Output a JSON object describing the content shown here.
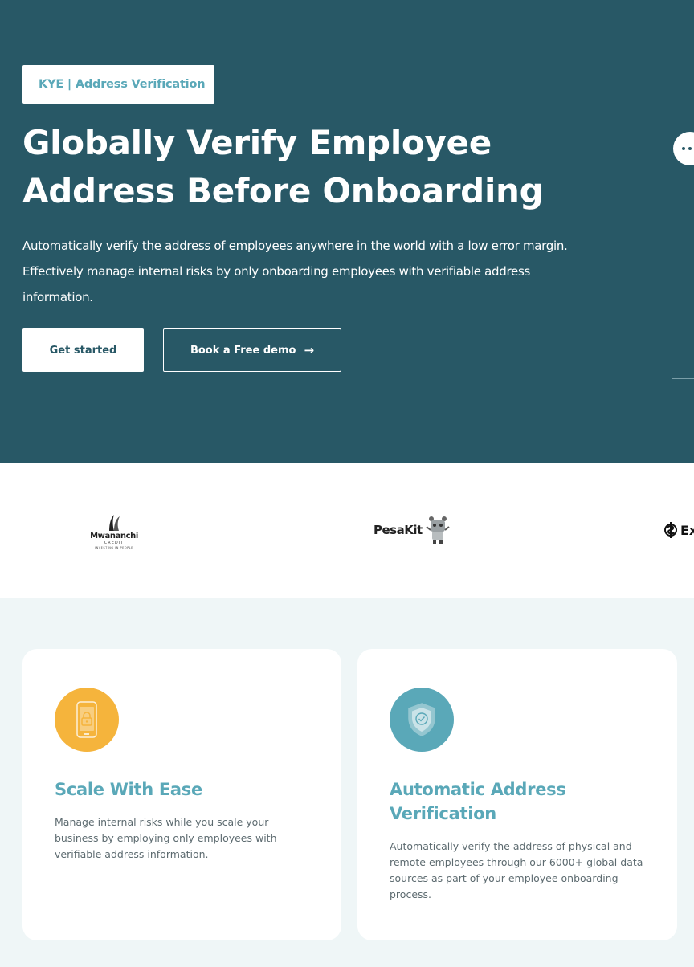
{
  "hero": {
    "tag": "KYE | Address Verification",
    "headline_line1": "Globally Verify Employee",
    "headline_line2": "Address Before Onboarding",
    "subtitle": "Automatically verify the address of employees anywhere in the world with a low error margin. Effectively manage internal risks by only onboarding employees with verifiable address information.",
    "primary_cta": "Get started",
    "secondary_cta": "Book a Free demo",
    "secondary_cta_icon": "arrow-right-icon",
    "background_color": "#285866",
    "accent_color": "#5aa8b8"
  },
  "logos": [
    {
      "name": "Mwananchi",
      "sub": "CREDIT",
      "tagline": "INVESTING IN PEOPLE"
    },
    {
      "name": "PesaKit"
    },
    {
      "name": "Ex"
    }
  ],
  "features": [
    {
      "icon": "phone-lock-icon",
      "icon_color": "#f5b43c",
      "title": "Scale With Ease",
      "description": "Manage internal risks while you scale your business by employing only employees with verifiable address information."
    },
    {
      "icon": "shield-check-icon",
      "icon_color": "#5aa8b8",
      "title": "Automatic Address Verification",
      "description": "Automatically verify the address of physical and remote employees through our 6000+ global data sources as part of your employee onboarding process."
    }
  ]
}
